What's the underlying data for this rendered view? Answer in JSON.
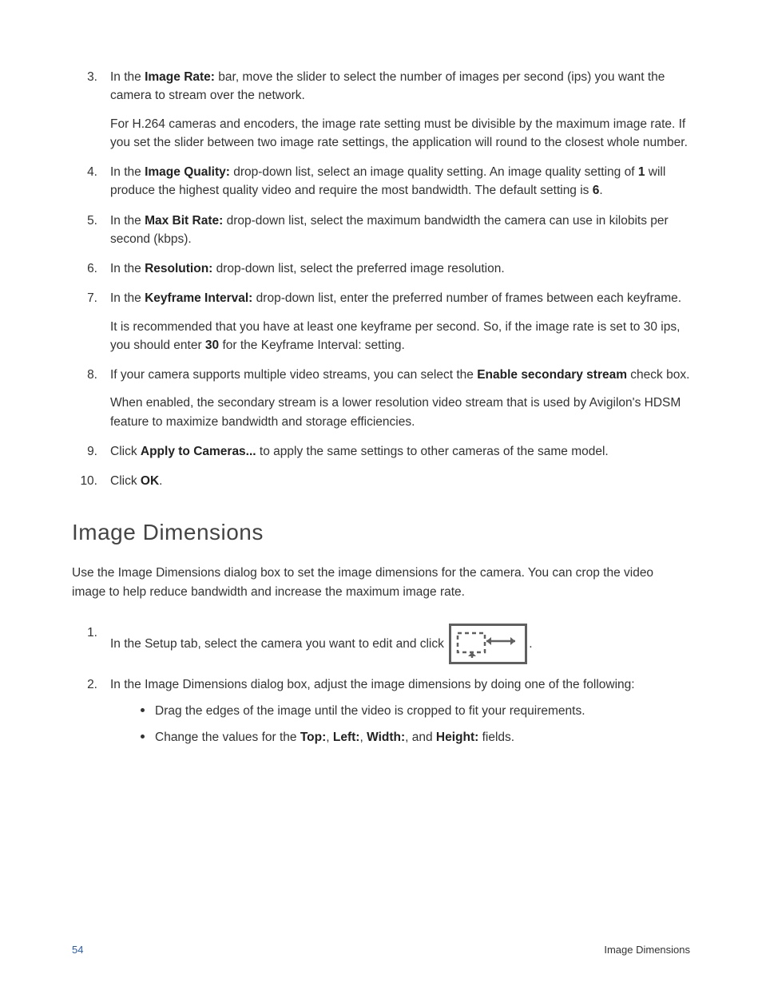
{
  "list1": {
    "start": 3,
    "items": [
      {
        "num": "3.",
        "pre": "In the ",
        "bold": "Image Rate:",
        "post": " bar, move the slider to select the number of images per second (ips) you want the camera to stream over the network.",
        "extra": "For H.264 cameras and encoders, the image rate setting must be divisible by the maximum image rate. If you set the slider between two image rate settings, the application will round to the closest whole number."
      },
      {
        "num": "4.",
        "pre": "In the ",
        "bold": "Image Quality:",
        "mid1": " drop-down list, select an image quality setting. An image quality setting of ",
        "bold2": "1",
        "mid2": " will produce the highest quality video and require the most bandwidth. The default setting is ",
        "bold3": "6",
        "post": "."
      },
      {
        "num": "5.",
        "pre": "In the ",
        "bold": "Max Bit Rate:",
        "post": " drop-down list, select the maximum bandwidth the camera can use in kilobits per second (kbps)."
      },
      {
        "num": "6.",
        "pre": "In the ",
        "bold": "Resolution:",
        "post": " drop-down list, select the preferred image resolution."
      },
      {
        "num": "7.",
        "pre": "In the ",
        "bold": "Keyframe Interval:",
        "post": " drop-down list, enter the preferred number of frames between each keyframe.",
        "extra_pre": "It is recommended that you have at least one keyframe per second. So, if the image rate is set to 30 ips, you should enter ",
        "extra_bold": "30",
        "extra_post": " for the Keyframe Interval: setting."
      },
      {
        "num": "8.",
        "pre": "If your camera supports multiple video streams, you can select the ",
        "bold": "Enable secondary stream",
        "post": " check box.",
        "extra": "When enabled, the secondary stream is a lower resolution video stream that is used by Avigilon's HDSM feature to maximize bandwidth and storage efficiencies."
      },
      {
        "num": "9.",
        "pre": "Click ",
        "bold": "Apply to Cameras...",
        "post": " to apply the same settings to other cameras of the same model."
      },
      {
        "num": "10.",
        "pre": "Click ",
        "bold": "OK",
        "post": "."
      }
    ]
  },
  "section": {
    "heading": "Image Dimensions",
    "intro": "Use the Image Dimensions dialog box to set the image dimensions for the camera. You can crop the video image to help reduce bandwidth and increase the maximum image rate."
  },
  "list2": {
    "items": [
      {
        "num": "1.",
        "text": "In the Setup tab, select the camera you want to edit and click ",
        "tail": "."
      },
      {
        "num": "2.",
        "text": "In the Image Dimensions dialog box, adjust the image dimensions by doing one of the following:",
        "bullets": [
          {
            "text": "Drag the edges of the image until the video is cropped to fit your requirements."
          },
          {
            "pre": "Change the values for the ",
            "b1": "Top:",
            "s1": ", ",
            "b2": "Left:",
            "s2": ", ",
            "b3": "Width:",
            "s3": ", and ",
            "b4": "Height:",
            "post": " fields."
          }
        ]
      }
    ]
  },
  "footer": {
    "page": "54",
    "title": "Image Dimensions"
  }
}
